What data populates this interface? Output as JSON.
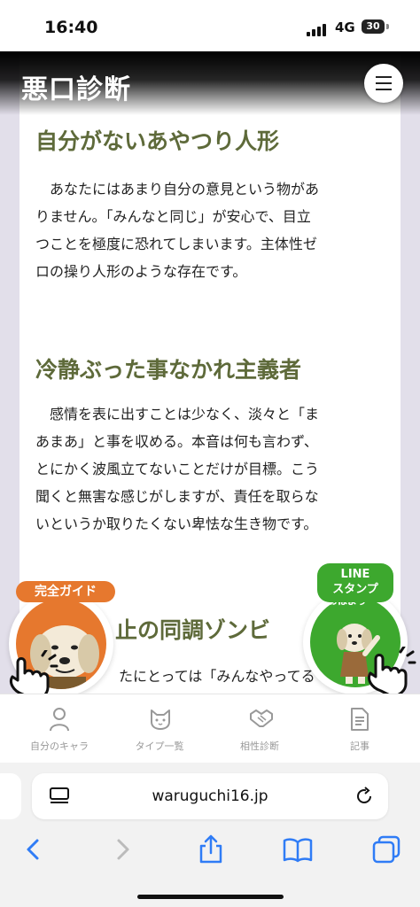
{
  "status": {
    "time": "16:40",
    "network": "4G",
    "battery": "30"
  },
  "header": {
    "site_title": "悪口診断"
  },
  "sections": [
    {
      "title": "自分がないあやつり人形",
      "lines": [
        "　あなたにはあまり自分の意見という物があ",
        "りません。「みんなと同じ」が安心で、目立",
        "つことを極度に恐れてしまいます。主体性ゼ",
        "ロの操り人形のような存在です。"
      ]
    },
    {
      "title": "冷静ぶった事なかれ主義者",
      "lines": [
        "　感情を表に出すことは少なく、淡々と「ま",
        "あまあ」と事を収める。本音は何も言わず、",
        "とにかく波風立てないことだけが目標。こう",
        "聞くと無害な感じがしますが、責任を取らな",
        "いというか取りたくない卑怯な生き物です。"
      ]
    },
    {
      "title": "止の同調ゾンビ",
      "lines": [
        "たにとっては「みんなやってる"
      ]
    }
  ],
  "float_guide": {
    "label": "完全ガイド"
  },
  "float_line": {
    "line1": "LINE",
    "line2": "スタンプ",
    "speech": "おはよう"
  },
  "tabbar": [
    {
      "label": "自分のキャラ",
      "icon": "person-icon"
    },
    {
      "label": "タイプ一覧",
      "icon": "cat-icon"
    },
    {
      "label": "相性診断",
      "icon": "handshake-icon"
    },
    {
      "label": "記事",
      "icon": "document-icon"
    }
  ],
  "browser": {
    "url": "waruguchi16.jp"
  },
  "colors": {
    "accent_olive": "#5e6a3a",
    "guide_orange": "#e6782e",
    "line_green": "#3da82e",
    "ios_blue": "#2f7cf6"
  }
}
